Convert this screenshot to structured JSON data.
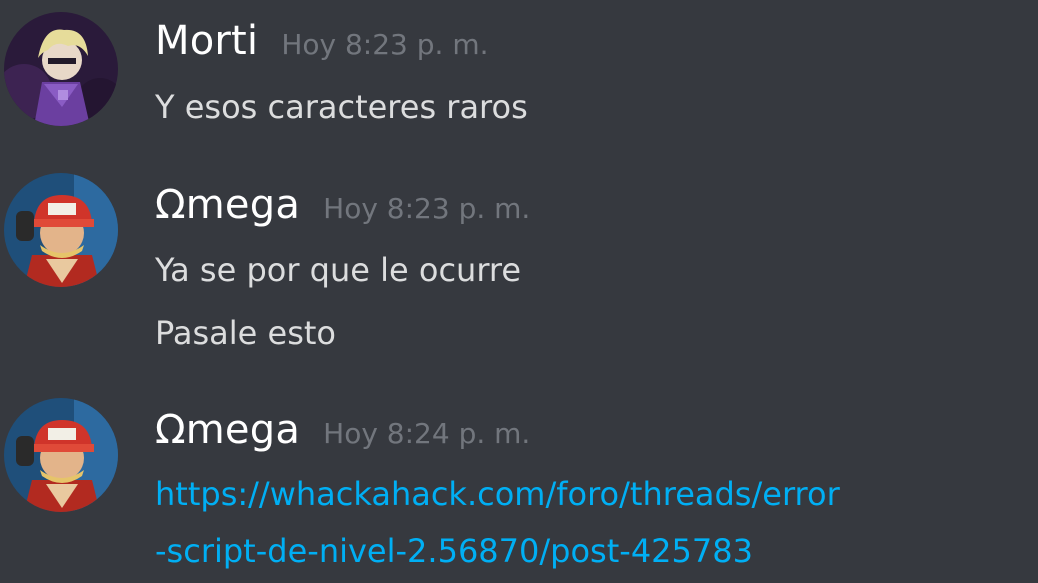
{
  "messages": [
    {
      "author": "Morti",
      "timestamp": "Hoy 8:23 p. m.",
      "avatar_icon": "dark-haired-character-avatar",
      "lines": [
        "Y esos caracteres raros"
      ]
    },
    {
      "author": "Ωmega",
      "timestamp": "Hoy 8:23 p. m.",
      "avatar_icon": "red-cap-fighter-avatar",
      "lines": [
        "Ya se por que le ocurre",
        "Pasale esto"
      ]
    },
    {
      "author": "Ωmega",
      "timestamp": "Hoy 8:24 p. m.",
      "avatar_icon": "red-cap-fighter-avatar",
      "link_lines": [
        "https://whackahack.com/foro/threads/error",
        "-script-de-nivel-2.56870/post-425783"
      ]
    }
  ],
  "colors": {
    "background": "#36393f",
    "username": "#ffffff",
    "timestamp": "#72767d",
    "text": "#dcddde",
    "link": "#00aff4"
  }
}
